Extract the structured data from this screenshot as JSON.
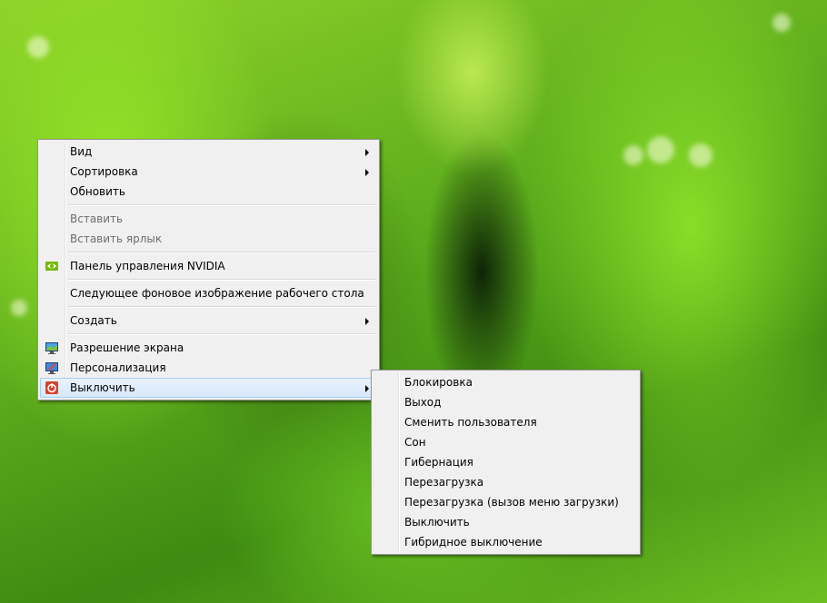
{
  "context_menu": {
    "items": {
      "view": "Вид",
      "sort": "Сортировка",
      "refresh": "Обновить",
      "paste": "Вставить",
      "paste_shortcut": "Вставить ярлык",
      "nvidia": "Панель управления NVIDIA",
      "next_background": "Следующее фоновое изображение рабочего стола",
      "create": "Создать",
      "screen_resolution": "Разрешение экрана",
      "personalize": "Персонализация",
      "shutdown": "Выключить"
    }
  },
  "shutdown_submenu": {
    "items": [
      "Блокировка",
      "Выход",
      "Сменить пользователя",
      "Сон",
      "Гибернация",
      "Перезагрузка",
      "Перезагрузка (вызов меню загрузки)",
      "Выключить",
      "Гибридное выключение"
    ]
  },
  "colors": {
    "menu_bg": "#f0f0f0",
    "highlight": "#d6e8fb",
    "disabled_text": "#6d6d6d"
  },
  "icons": {
    "nvidia": "nvidia-icon",
    "screen_resolution": "monitor-icon",
    "personalize": "personalize-icon",
    "shutdown": "power-icon"
  }
}
